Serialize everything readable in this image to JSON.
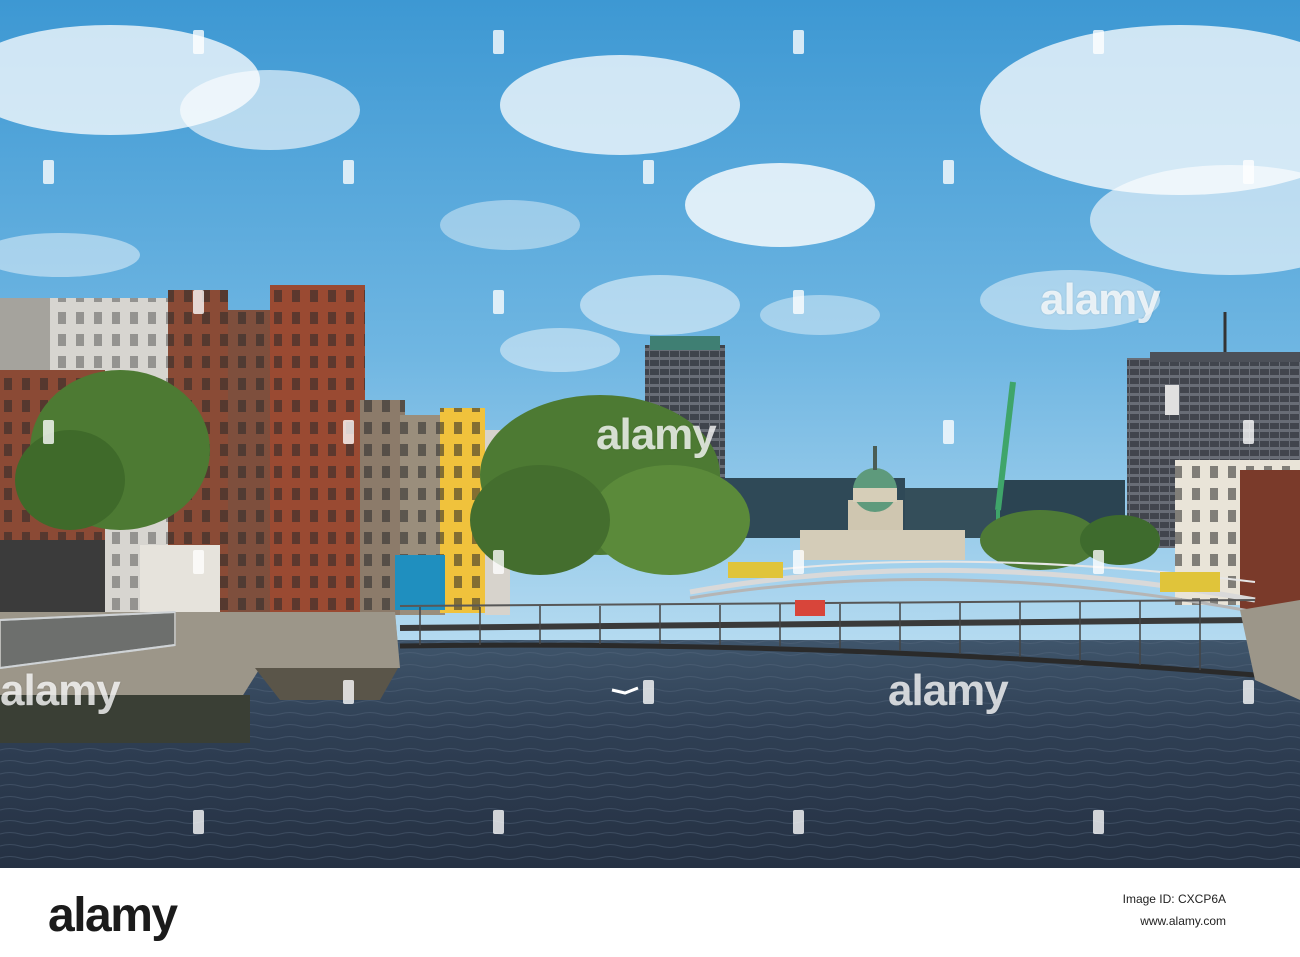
{
  "watermark": {
    "text": "alamy"
  },
  "footer": {
    "logo_text": "alamy",
    "stock_id": "Image ID: CXCP6A",
    "url": "www.alamy.com"
  },
  "colors": {
    "sky_top": "#3d98d3",
    "sky_bottom": "#a7d3ee",
    "river": "#2c3b4f",
    "brick": "#8b4a35",
    "tree_green": "#4d7a33",
    "dome_green": "#5e9a7c",
    "crane": "#3fa56a",
    "footer_bg": "#ffffff"
  }
}
